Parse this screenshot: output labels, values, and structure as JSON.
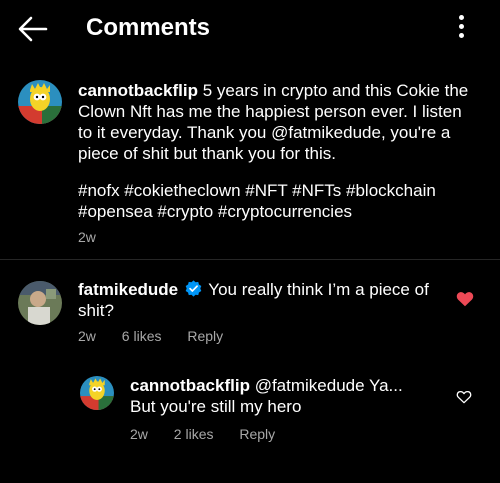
{
  "header": {
    "title": "Comments"
  },
  "caption": {
    "username": "cannotbackflip",
    "text": "5 years in crypto and this Cokie the Clown Nft has me the happiest person ever. I listen to it everyday. Thank you @fatmikedude, you're a piece of shit but thank you for this.",
    "hashtags_line1": "#nofx #cokietheclown #NFT #NFTs #blockchain",
    "hashtags_line2": "#opensea #crypto #cryptocurrencies",
    "time": "2w"
  },
  "comments": [
    {
      "username": "fatmikedude",
      "verified": true,
      "text": "You really think I’m a piece of shit?",
      "time": "2w",
      "likes": "6 likes",
      "reply_label": "Reply",
      "liked": true
    },
    {
      "username": "cannotbackflip",
      "text": "@fatmikedude Ya... But you're still my hero",
      "time": "2w",
      "likes": "2 likes",
      "reply_label": "Reply",
      "liked": false
    }
  ],
  "colors": {
    "liked_heart": "#ed4956",
    "verified_badge": "#0095f6",
    "meta_text": "#a8a8a8"
  }
}
